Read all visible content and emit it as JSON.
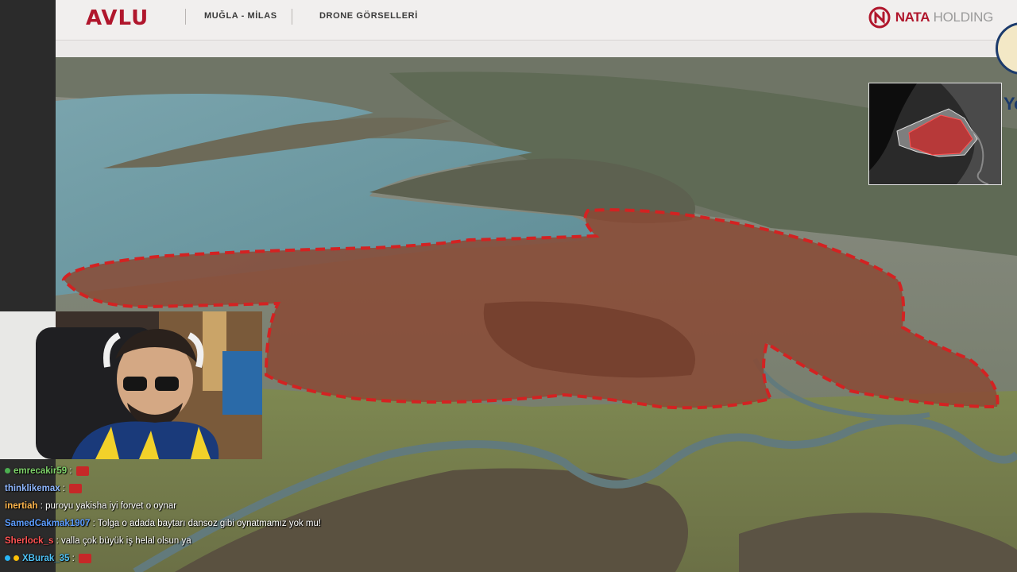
{
  "header": {
    "logo": "AVLU",
    "location": "MUĞLA - MİLAS",
    "section": "DRONE GÖRSELLERİ",
    "brand_main": "NATA",
    "brand_sub": "HOLDING",
    "side_letter": "Yo"
  },
  "colors": {
    "brand_red": "#b0162c",
    "header_bg": "#f1efee",
    "highlight_red": "#d32222"
  },
  "chat": {
    "messages": [
      {
        "user": "emrecakir59",
        "color": "#7fd36b",
        "text": ":",
        "emote": "red-emote"
      },
      {
        "user": "thinklikemax",
        "color": "#8fb7ff",
        "text": ":",
        "emote": "red-emote"
      },
      {
        "user": "inertiah",
        "color": "#ffb74d",
        "text": ": puroyu yakisha iyi forvet o oynar",
        "emote": ""
      },
      {
        "user": "SamedCakmak1907",
        "color": "#5c9dff",
        "text": ": Tolga o adada baytarı dansoz gibi oynatmamız yok mu!",
        "emote": ""
      },
      {
        "user": "Sherlock_s",
        "color": "#ff5252",
        "text": ": valla çok büyük iş helal olsun ya",
        "emote": ""
      },
      {
        "user": "XBurak_35",
        "color": "#4fc3f7",
        "text": ":",
        "emote": "red-emote"
      }
    ]
  }
}
